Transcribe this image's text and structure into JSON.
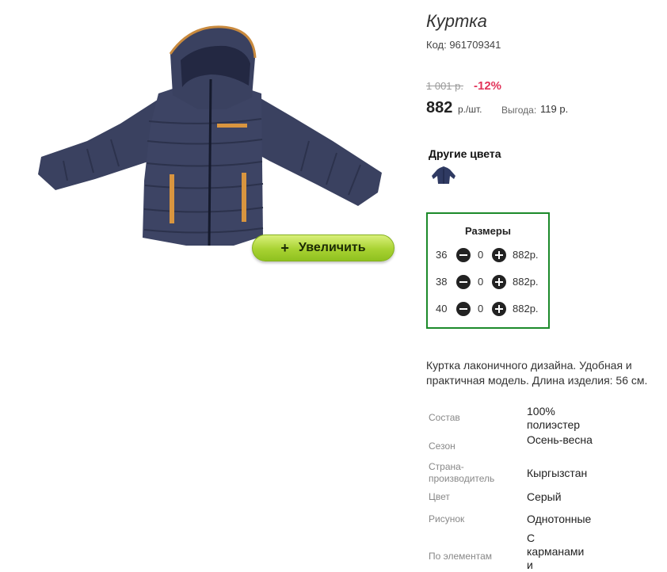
{
  "product": {
    "title": "Куртка",
    "code": "Код: 961709341",
    "old_price": "1 001 р.",
    "discount": "-12%",
    "price": "882",
    "unit": "р./шт.",
    "profit_label": "Выгода:",
    "profit_value": "119 р.",
    "zoom_label": "Увеличить",
    "zoom_plus": "+"
  },
  "other_colors": {
    "title": "Другие цвета",
    "swatch_icon": "jacket-thumbnail-icon",
    "swatch_color": "#2f3a62"
  },
  "sizes": {
    "title": "Размеры",
    "items": [
      {
        "size": "36",
        "qty": "0",
        "price": "882р."
      },
      {
        "size": "38",
        "qty": "0",
        "price": "882р."
      },
      {
        "size": "40",
        "qty": "0",
        "price": "882р."
      }
    ]
  },
  "description": "Куртка лаконичного дизайна. Удобная и практичная модель. Длина изделия: 56 см.",
  "properties": [
    {
      "label": "Состав",
      "value": "100% полиэстер"
    },
    {
      "label": "Сезон",
      "value": "Осень-весна"
    },
    {
      "label": "Страна-производитель",
      "value": "Кыргызстан"
    },
    {
      "label": "Цвет",
      "value": "Серый"
    },
    {
      "label": "Рисунок",
      "value": "Однотонные"
    },
    {
      "label": "По элементам",
      "value": "С карманами и"
    }
  ],
  "colors": {
    "accent_green": "#1c8a2a",
    "button_green": "#a8d232",
    "discount_red": "#e2345a",
    "jacket_navy": "#3a4160",
    "jacket_trim": "#d9953f"
  }
}
